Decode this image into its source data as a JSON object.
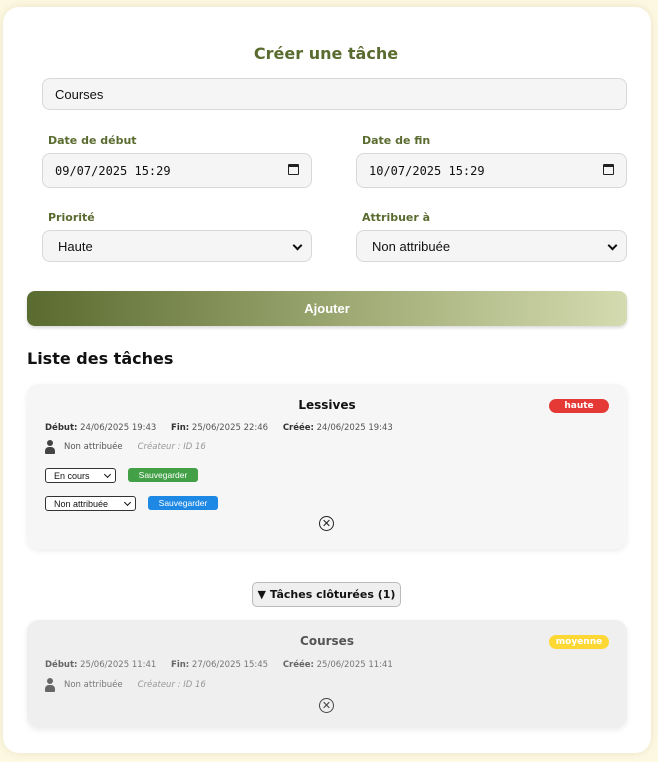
{
  "form": {
    "title": "Créer une tâche",
    "name_value": "Courses",
    "start_label": "Date de début",
    "start_value": "09/07/2025 15:29",
    "end_label": "Date de fin",
    "end_value": "10/07/2025 15:29",
    "priority_label": "Priorité",
    "priority_value": "Haute",
    "assign_label": "Attribuer à",
    "assign_value": "Non attribuée",
    "submit_label": "Ajouter",
    "submit_gradient": [
      "#5a6b2f",
      "#d4dbb0"
    ]
  },
  "list": {
    "title": "Liste des tâches",
    "tasks": [
      {
        "title": "Lessives",
        "priority": "haute",
        "priority_color": "#e53935",
        "start_label": "Début:",
        "start": "24/06/2025 19:43",
        "end_label": "Fin:",
        "end": "25/06/2025 22:46",
        "created_label": "Créée:",
        "created": "24/06/2025 19:43",
        "assignee": "Non attribuée",
        "creator": "Créateur : ID 16",
        "status_value": "En cours",
        "save_status_label": "Sauvegarder",
        "assign_value": "Non attribuée",
        "save_assign_label": "Sauvegarder",
        "delete_symbol": "✕"
      }
    ]
  },
  "closed": {
    "toggle_label": "▼ Tâches clôturées (1)",
    "tasks": [
      {
        "title": "Courses",
        "priority": "moyenne",
        "priority_color": "#fdd835",
        "start_label": "Début:",
        "start": "25/06/2025 11:41",
        "end_label": "Fin:",
        "end": "27/06/2025 15:45",
        "created_label": "Créée:",
        "created": "25/06/2025 11:41",
        "assignee": "Non attribuée",
        "creator": "Créateur : ID 16",
        "delete_symbol": "✕"
      }
    ]
  },
  "colors": {
    "background": "#fdf8e2",
    "accent": "#5a6b2f",
    "save_green": "#43a047",
    "save_blue": "#1e88e5"
  }
}
